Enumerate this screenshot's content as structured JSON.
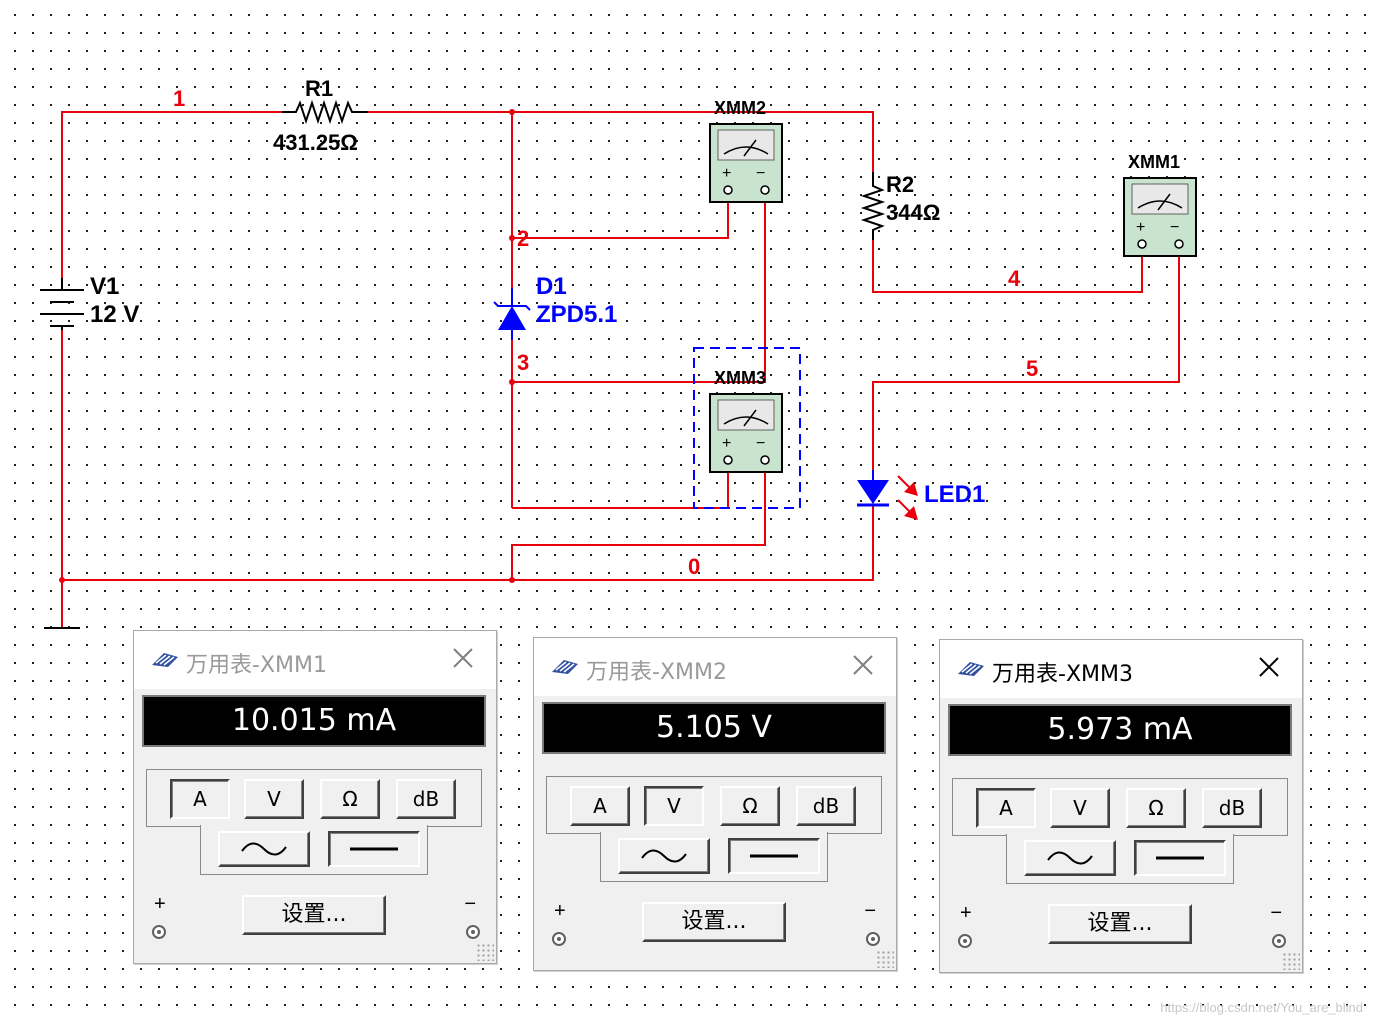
{
  "schematic": {
    "nodes": [
      "1",
      "2",
      "3",
      "4",
      "5",
      "0"
    ],
    "components": {
      "R1": {
        "name": "R1",
        "value": "431.25Ω"
      },
      "R2": {
        "name": "R2",
        "value": "344Ω"
      },
      "V1": {
        "name": "V1",
        "value": "12 V"
      },
      "D1": {
        "name": "D1",
        "value": "ZPD5.1"
      },
      "LED1": {
        "name": "LED1"
      },
      "XMM1": {
        "name": "XMM1"
      },
      "XMM2": {
        "name": "XMM2"
      },
      "XMM3": {
        "name": "XMM3"
      }
    },
    "meter_symbols": {
      "plus": "+",
      "minus": "−"
    }
  },
  "multimeters": [
    {
      "title": "万用表-XMM1",
      "reading": "10.015 mA",
      "active_mode": "A",
      "active": false
    },
    {
      "title": "万用表-XMM2",
      "reading": "5.105 V",
      "active_mode": "V",
      "active": false
    },
    {
      "title": "万用表-XMM3",
      "reading": "5.973 mA",
      "active_mode": "A",
      "active": true
    }
  ],
  "mode_labels": {
    "A": "A",
    "V": "V",
    "ohm": "Ω",
    "dB": "dB"
  },
  "settings_label": "设置...",
  "terminal_labels": {
    "plus": "+",
    "minus": "−"
  },
  "colors": {
    "wire": "#e8000b",
    "component": "#0000ff",
    "selection": "#0000ff",
    "text": "#000000"
  },
  "watermark": "https://blog.csdn.net/You_are_blind"
}
